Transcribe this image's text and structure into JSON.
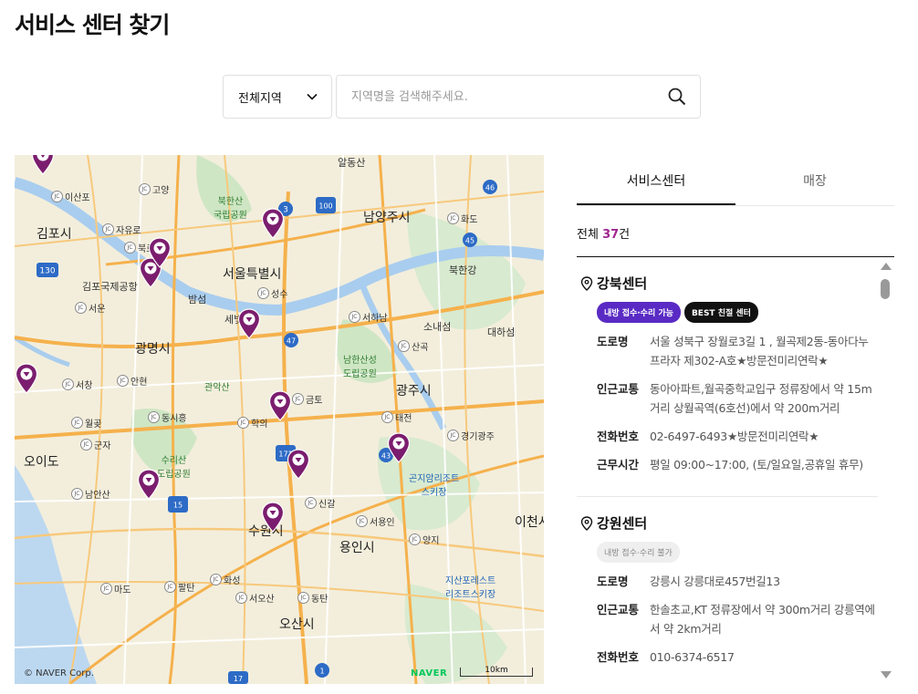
{
  "page": {
    "title": "서비스 센터 찾기"
  },
  "filter": {
    "region": "전체지역",
    "search_placeholder": "지역명을 검색해주세요."
  },
  "map": {
    "copyright": "© NAVER Corp.",
    "logo": "NAVER",
    "scale": "10km",
    "cities": [
      "김포시",
      "서울특별시",
      "광명시",
      "남양주시",
      "광주시",
      "오이도",
      "수원시",
      "용인시",
      "오산시",
      "이천시",
      "소내섬",
      "대하섬"
    ],
    "mountains": [
      "북한산\n국립공원",
      "남한산성\n도립공원",
      "수리산\n도립공원",
      "관악산"
    ],
    "ski": [
      "곤지암리조트\n스키장",
      "지산포레스트\n리조트스키장"
    ],
    "places": [
      "김포국제공항",
      "밤섬",
      "세빛",
      "알동산",
      "북한강"
    ],
    "junctions": [
      "이산포",
      "고양",
      "자유로",
      "북로",
      "서운",
      "안현",
      "서창",
      "동시흥",
      "월곶",
      "군자",
      "남안산",
      "학의",
      "금토",
      "성수",
      "서하남",
      "산곡",
      "화도",
      "태전",
      "경기광주",
      "신갈",
      "서용인",
      "양지",
      "서오산",
      "동탄",
      "화성",
      "팔탄",
      "마도"
    ],
    "routes": [
      "130",
      "3",
      "100",
      "46",
      "45",
      "47",
      "171",
      "43",
      "15",
      "1",
      "17"
    ],
    "pins": 11
  },
  "tabs": [
    {
      "label": "서비스센터",
      "active": true
    },
    {
      "label": "매장",
      "active": false
    }
  ],
  "summary": {
    "prefix": "전체 ",
    "count": "37",
    "suffix": "건"
  },
  "centers": [
    {
      "name": "강북센터",
      "badges": [
        {
          "label": "내방 접수·수리 가능",
          "style": "purple"
        },
        {
          "label": "BEST 친절 센터",
          "style": "black"
        }
      ],
      "rows": [
        {
          "key": "도로명",
          "value": "서울 성북구 장월로3길 1 , 월곡제2동-동아다누 프라자 제302-A호★방문전미리연락★"
        },
        {
          "key": "인근교통",
          "value": "동아아파트,월곡중학교입구 정류장에서 약 15m거리 상월곡역(6호선)에서 약 200m거리"
        },
        {
          "key": "전화번호",
          "value": "02-6497-6493★방문전미리연락★"
        },
        {
          "key": "근무시간",
          "value": "평일 09:00~17:00, (토/일요일,공휴일 휴무)"
        }
      ]
    },
    {
      "name": "강원센터",
      "badges": [
        {
          "label": "내방 접수·수리 불가",
          "style": "gray"
        }
      ],
      "rows": [
        {
          "key": "도로명",
          "value": "강릉시 강릉대로457번길13"
        },
        {
          "key": "인근교통",
          "value": "한솔초교,KT 정류장에서 약 300m거리 강릉역에서 약 2km거리"
        },
        {
          "key": "전화번호",
          "value": "010-6374-6517"
        }
      ]
    }
  ],
  "colors": {
    "accent": "#a0258f",
    "pin": "#7b1d6e",
    "badge_purple": "#5a2bc4"
  }
}
